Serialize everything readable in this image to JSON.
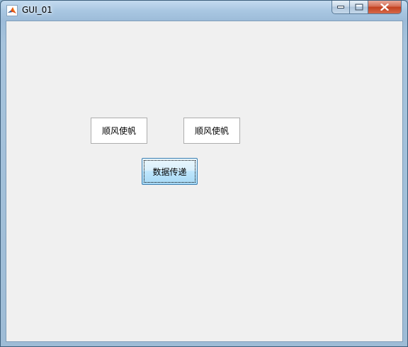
{
  "window": {
    "title": "GUI_01",
    "icon": "matlab-icon",
    "controls": {
      "minimize_icon": "minimize-icon",
      "maximize_icon": "maximize-icon",
      "close_icon": "close-icon"
    }
  },
  "buttons": {
    "button_1_label": "顺风使帆",
    "button_2_label": "顺风使帆",
    "transfer_label": "数据传递"
  },
  "colors": {
    "client_background": "#f0f0f0",
    "focused_button": "#bee6fd",
    "close_button": "#c2401f"
  }
}
